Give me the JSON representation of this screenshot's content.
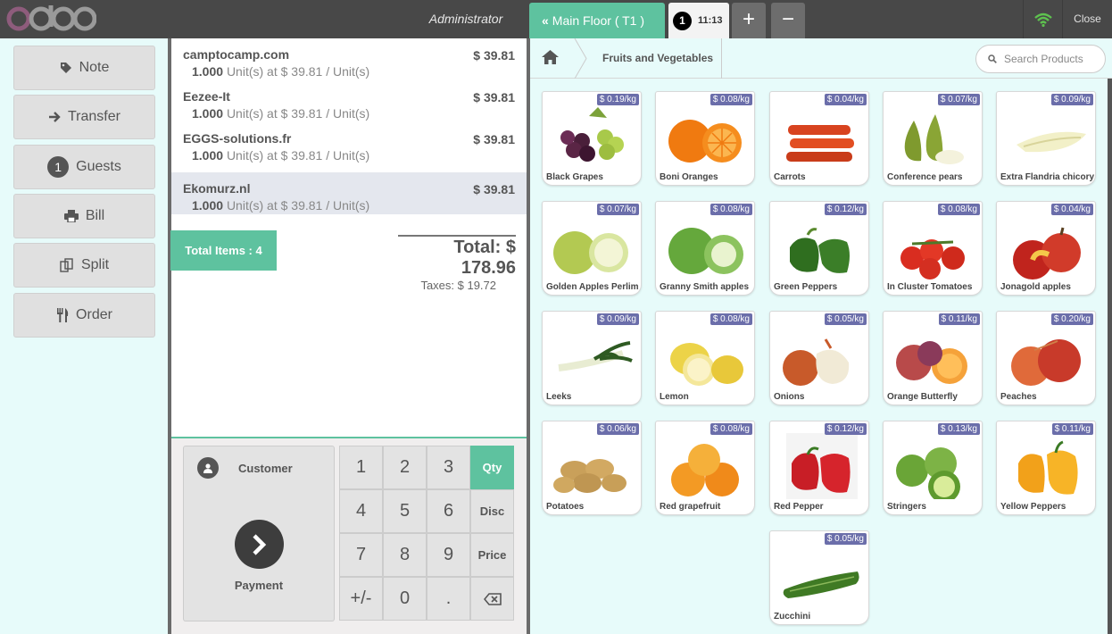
{
  "header": {
    "user": "Administrator",
    "floor_button": "Main Floor ( T1 )",
    "order_tab": {
      "number": "1",
      "time": "11:13"
    },
    "add_order": "+",
    "remove_order": "−",
    "close_label": "Close"
  },
  "controls": [
    {
      "label": "Note",
      "icon": "tag-icon"
    },
    {
      "label": "Transfer",
      "icon": "arrow-right-icon"
    },
    {
      "label": "Guests",
      "icon": "guest-count-badge",
      "badge": "1"
    },
    {
      "label": "Bill",
      "icon": "print-icon"
    },
    {
      "label": "Split",
      "icon": "split-icon"
    },
    {
      "label": "Order",
      "icon": "cutlery-icon"
    }
  ],
  "orderlines": [
    {
      "name": "camptocamp.com",
      "price": "$ 39.81",
      "qty": "1.000",
      "detail": "Unit(s) at $ 39.81 / Unit(s)"
    },
    {
      "name": "Eezee-It",
      "price": "$ 39.81",
      "qty": "1.000",
      "detail": "Unit(s) at $ 39.81 / Unit(s)"
    },
    {
      "name": "EGGS-solutions.fr",
      "price": "$ 39.81",
      "qty": "1.000",
      "detail": "Unit(s) at $ 39.81 / Unit(s)"
    },
    {
      "name": "Ekomurz.nl",
      "price": "$ 39.81",
      "qty": "1.000",
      "detail": "Unit(s) at $ 39.81 / Unit(s)",
      "selected": true
    }
  ],
  "summary": {
    "total_items": "Total Items : 4",
    "total": "Total: $ 178.96",
    "taxes": "Taxes: $ 19.72"
  },
  "actionpad": {
    "customer": "Customer",
    "payment": "Payment"
  },
  "numpad": {
    "keys": [
      "1",
      "2",
      "3",
      "4",
      "5",
      "6",
      "7",
      "8",
      "9",
      "+/-",
      "0",
      "."
    ],
    "modes": [
      "Qty",
      "Disc",
      "Price"
    ],
    "selected_mode": "Qty",
    "backspace_icon": "backspace-icon"
  },
  "breadcrumb": {
    "home_icon": "home-icon",
    "category": "Fruits and Vegetables"
  },
  "search": {
    "placeholder": "Search Products"
  },
  "products": [
    {
      "name": "Black Grapes",
      "price": "$ 0.19/kg"
    },
    {
      "name": "Boni Oranges",
      "price": "$ 0.08/kg"
    },
    {
      "name": "Carrots",
      "price": "$ 0.04/kg"
    },
    {
      "name": "Conference pears",
      "price": "$ 0.07/kg"
    },
    {
      "name": "Extra Flandria chicory",
      "price": "$ 0.09/kg"
    },
    {
      "name": "Golden Apples Perlim",
      "price": "$ 0.07/kg"
    },
    {
      "name": "Granny Smith apples",
      "price": "$ 0.08/kg"
    },
    {
      "name": "Green Peppers",
      "price": "$ 0.12/kg"
    },
    {
      "name": "In Cluster Tomatoes",
      "price": "$ 0.08/kg"
    },
    {
      "name": "Jonagold apples",
      "price": "$ 0.04/kg"
    },
    {
      "name": "Leeks",
      "price": "$ 0.09/kg"
    },
    {
      "name": "Lemon",
      "price": "$ 0.08/kg"
    },
    {
      "name": "Onions",
      "price": "$ 0.05/kg"
    },
    {
      "name": "Orange Butterfly",
      "price": "$ 0.11/kg"
    },
    {
      "name": "Peaches",
      "price": "$ 0.20/kg"
    },
    {
      "name": "Potatoes",
      "price": "$ 0.06/kg"
    },
    {
      "name": "Red grapefruit",
      "price": "$ 0.08/kg"
    },
    {
      "name": "Red Pepper",
      "price": "$ 0.12/kg"
    },
    {
      "name": "Stringers",
      "price": "$ 0.13/kg"
    },
    {
      "name": "Yellow Peppers",
      "price": "$ 0.11/kg"
    },
    {
      "name": "Zucchini",
      "price": "$ 0.05/kg"
    }
  ],
  "colors": {
    "accent": "#5ec29f",
    "price_tag": "#6b6eaa",
    "topbar": "#484848"
  }
}
